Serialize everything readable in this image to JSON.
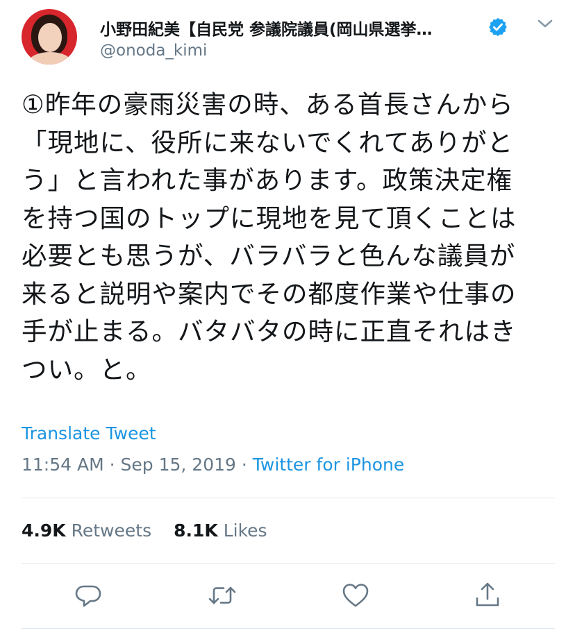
{
  "header": {
    "display_name": "小野田紀美【自民党 参議院議員(岡山県選挙…",
    "handle": "@onoda_kimi",
    "avatar_icon": "user-avatar-photo",
    "verified_icon": "verified-badge-icon",
    "menu_icon": "chevron-down-icon"
  },
  "tweet": {
    "text": "①昨年の豪雨災害の時、ある首長さんから\n「現地に、役所に来ないでくれてありがと\nう」と言われた事があります。政策決定権\nを持つ国のトップに現地を見て頂くことは\n必要とも思うが、バラバラと色んな議員が\n来ると説明や案内でその都度作業や仕事の\n手が止まる。バタバタの時に正直それはき\nつい。と。",
    "translate_label": "Translate Tweet",
    "time": "11:54 AM",
    "date": "Sep 15, 2019",
    "separator": "·",
    "source": "Twitter for iPhone"
  },
  "stats": {
    "retweets_count": "4.9K",
    "retweets_label": "Retweets",
    "likes_count": "8.1K",
    "likes_label": "Likes"
  },
  "actions": [
    {
      "name": "reply",
      "icon": "reply-icon"
    },
    {
      "name": "retweet",
      "icon": "retweet-icon"
    },
    {
      "name": "like",
      "icon": "heart-icon"
    },
    {
      "name": "share",
      "icon": "share-icon"
    }
  ],
  "colors": {
    "accent": "#1b95e0",
    "secondary_text": "#657786",
    "avatar_background": "#d8262d"
  }
}
